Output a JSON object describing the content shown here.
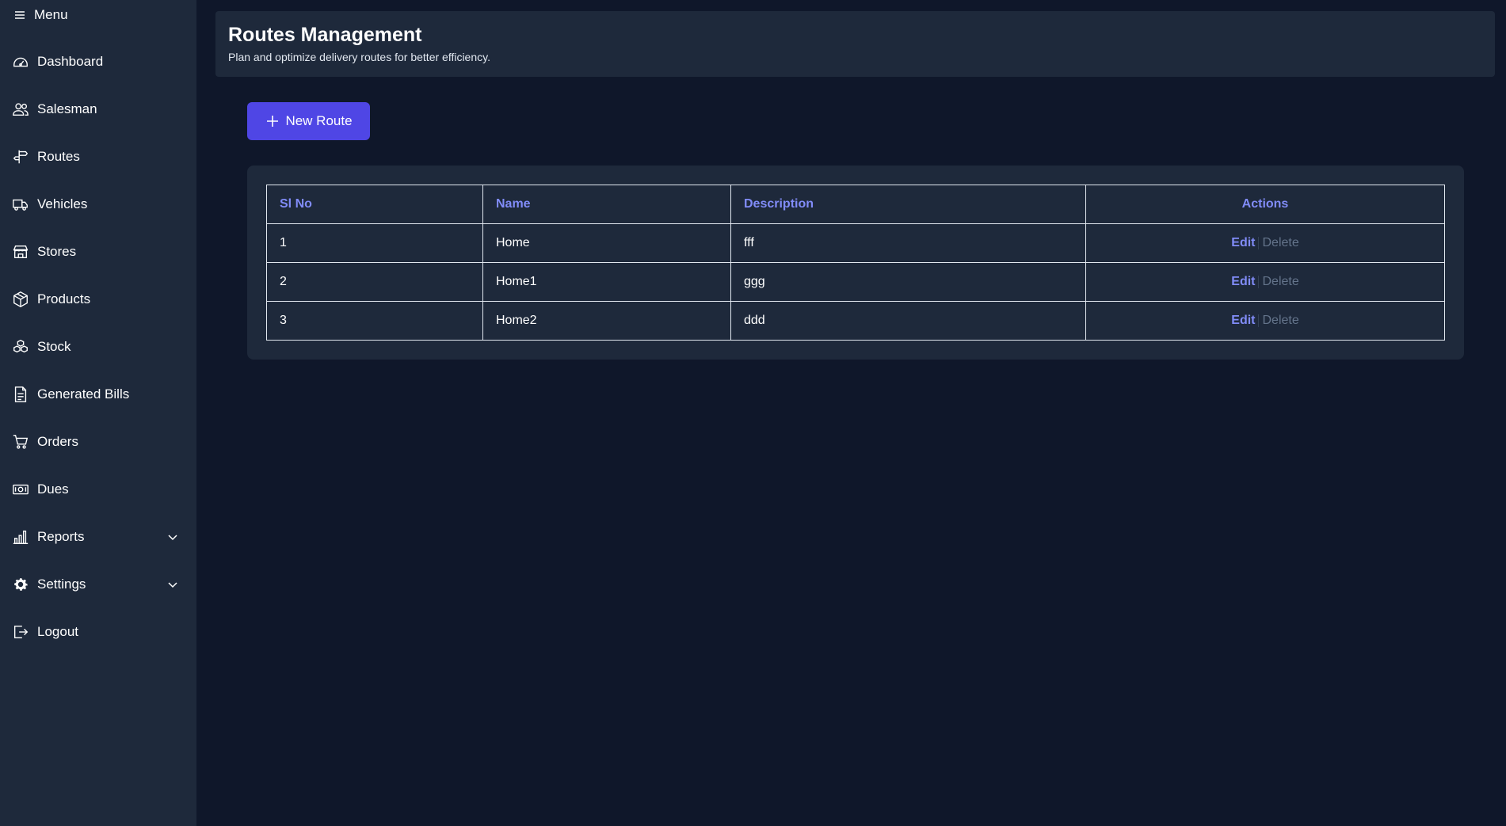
{
  "sidebar": {
    "menu_label": "Menu",
    "items": [
      {
        "label": "Dashboard",
        "icon": "dashboard-gauge-icon"
      },
      {
        "label": "Salesman",
        "icon": "users-icon"
      },
      {
        "label": "Routes",
        "icon": "signpost-icon"
      },
      {
        "label": "Vehicles",
        "icon": "truck-icon"
      },
      {
        "label": "Stores",
        "icon": "store-icon"
      },
      {
        "label": "Products",
        "icon": "box-icon"
      },
      {
        "label": "Stock",
        "icon": "stack-icon"
      },
      {
        "label": "Generated Bills",
        "icon": "document-icon"
      },
      {
        "label": "Orders",
        "icon": "cart-icon"
      },
      {
        "label": "Dues",
        "icon": "money-icon"
      },
      {
        "label": "Reports",
        "icon": "bar-chart-icon",
        "expandable": true
      },
      {
        "label": "Settings",
        "icon": "gear-icon",
        "expandable": true
      },
      {
        "label": "Logout",
        "icon": "logout-icon"
      }
    ]
  },
  "header": {
    "title": "Routes Management",
    "subtitle": "Plan and optimize delivery routes for better efficiency."
  },
  "new_route_button": "New Route",
  "table": {
    "columns": [
      "Sl No",
      "Name",
      "Description",
      "Actions"
    ],
    "rows": [
      {
        "sl": "1",
        "name": "Home",
        "description": "fff"
      },
      {
        "sl": "2",
        "name": "Home1",
        "description": "ggg"
      },
      {
        "sl": "3",
        "name": "Home2",
        "description": "ddd"
      }
    ],
    "edit_label": "Edit",
    "delete_label": "Delete"
  },
  "colors": {
    "background": "#0f172a",
    "panel": "#1e293b",
    "accent": "#4f46e5",
    "link": "#818cf8",
    "muted": "#64748b"
  }
}
